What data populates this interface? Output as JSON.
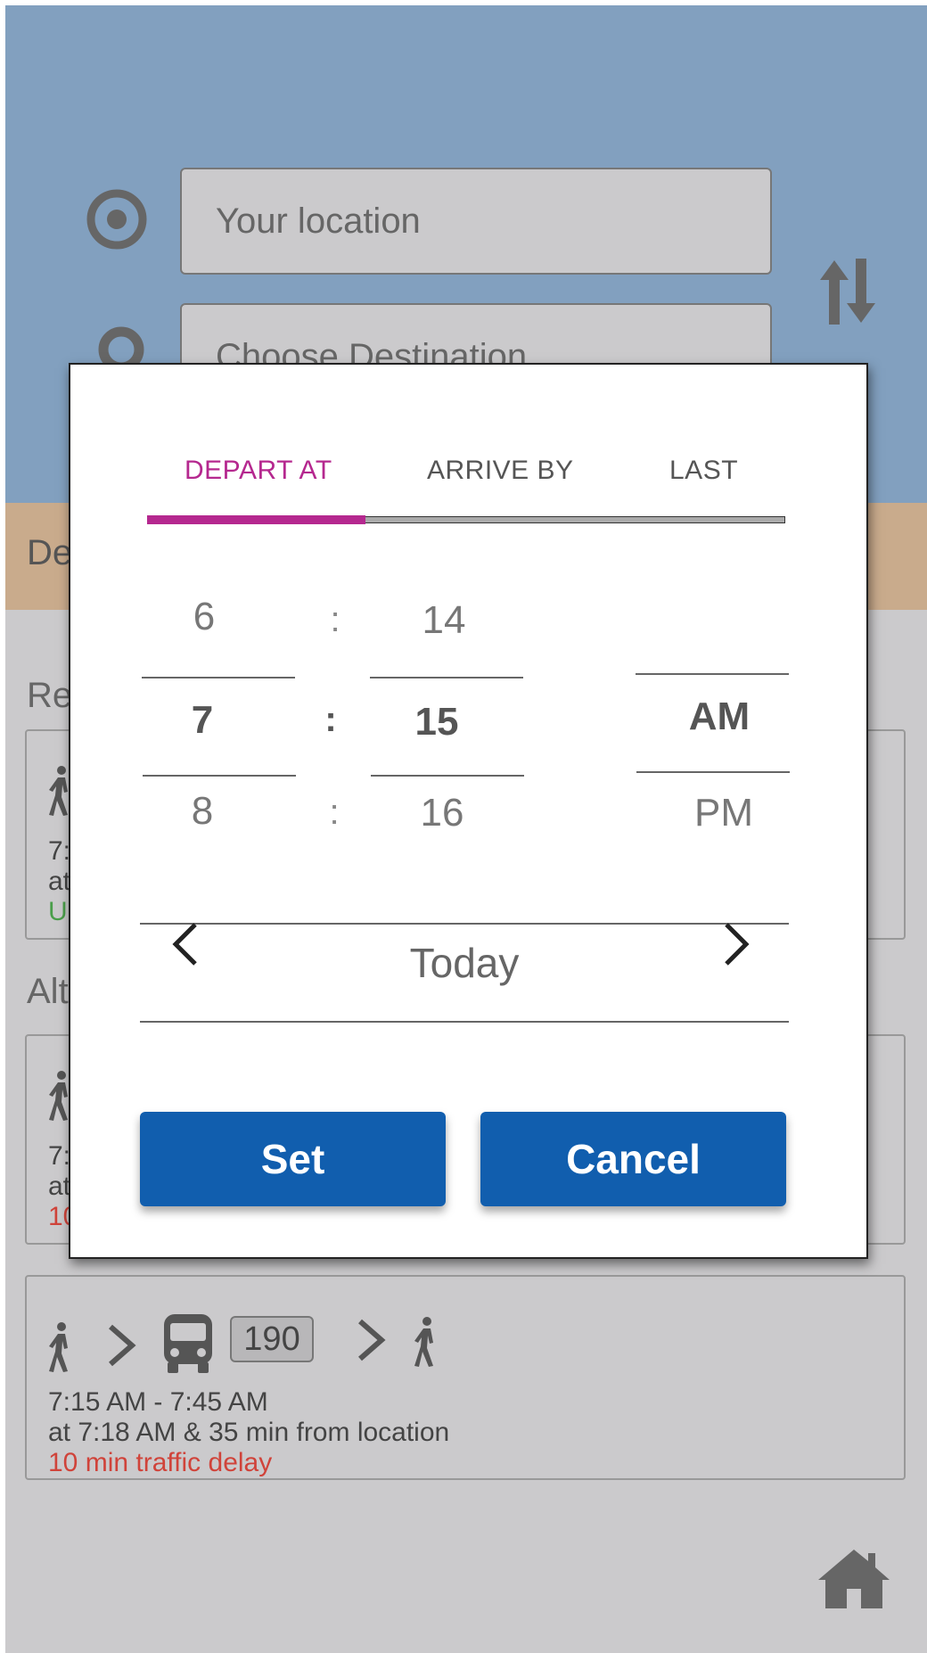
{
  "search": {
    "origin_placeholder": "Your location",
    "destination_placeholder": "Choose Destination"
  },
  "depart_bar": {
    "label": "De"
  },
  "sections": {
    "recommended": "Re",
    "alternatives": "Alt"
  },
  "routes": [
    {
      "line1": "7:",
      "line2": "at",
      "line3": "U"
    },
    {
      "line1": "7:",
      "line2": "at",
      "line3": "10"
    },
    {
      "route_number": "190",
      "time_range": "7:15 AM - 7:45 AM",
      "detail": "at 7:18 AM & 35 min from location",
      "delay": "10 min traffic delay"
    }
  ],
  "modal": {
    "tabs": [
      "DEPART AT",
      "ARRIVE BY",
      "LAST"
    ],
    "active_tab": "DEPART AT",
    "hours": [
      "6",
      "7",
      "8"
    ],
    "minutes": [
      "14",
      "15",
      "16"
    ],
    "separator": ":",
    "periods": [
      "AM",
      "PM"
    ],
    "selected": {
      "hour": "7",
      "minute": "15",
      "period": "AM"
    },
    "date_label": "Today",
    "set_label": "Set",
    "cancel_label": "Cancel"
  },
  "colors": {
    "header_bg": "#82a0bf",
    "depart_bar_bg": "#c9ab8c",
    "app_bg": "#cbcacc",
    "accent": "#b5288f",
    "button_bg": "#115eae",
    "delay": "#d0433a",
    "ok": "#4a9e4a"
  }
}
